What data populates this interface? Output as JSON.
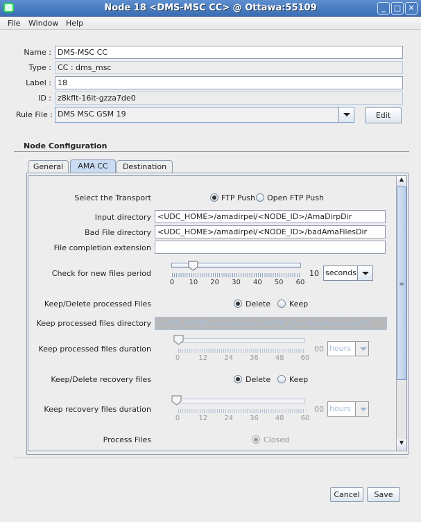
{
  "window": {
    "title": "Node 18 <DMS-MSC CC> @ Ottawa:55109",
    "controls": [
      "_",
      "□",
      "✕"
    ]
  },
  "menu": [
    "File",
    "Window",
    "Help"
  ],
  "form": {
    "name": {
      "label": "Name :",
      "value": "DMS-MSC CC"
    },
    "type": {
      "label": "Type :",
      "value": "CC : dms_msc"
    },
    "label": {
      "label": "Label :",
      "value": "18"
    },
    "id": {
      "label": "ID :",
      "value": "z8kflt-16it-gzza7de0"
    },
    "rule_file": {
      "label": "Rule File :",
      "value": "DMS MSC GSM 19",
      "edit": "Edit"
    }
  },
  "node_config": {
    "title": "Node Configuration",
    "tabs": [
      {
        "label": "General"
      },
      {
        "label": "AMA CC",
        "active": true
      },
      {
        "label": "Destination"
      }
    ],
    "transport": {
      "label": "Select the Transport",
      "options": [
        "FTP Push",
        "Open FTP Push"
      ],
      "selected": "FTP Push"
    },
    "input_dir": {
      "label": "Input directory",
      "value": "<UDC_HOME>/amadirpei/<NODE_ID>/AmaDirpDir"
    },
    "bad_dir": {
      "label": "Bad File directory",
      "value": "<UDC_HOME>/amadirpei/<NODE_ID>/badAmaFilesDir"
    },
    "completion_ext": {
      "label": "File completion extension",
      "value": ""
    },
    "check_period": {
      "label": "Check for new files period",
      "value": 10,
      "value_text": "10",
      "min": 0,
      "max": 60,
      "ticks": [
        "0",
        "10",
        "20",
        "30",
        "40",
        "50",
        "60"
      ],
      "unit": "seconds"
    },
    "keep_delete_processed": {
      "label": "Keep/Delete processed Files",
      "options": [
        "Delete",
        "Keep"
      ],
      "selected": "Delete"
    },
    "keep_processed_dir": {
      "label": "Keep processed files directory",
      "value": "<UDC_HOME>/amadirpei/<NODE_ID>/AmaFilesKeepDir"
    },
    "keep_processed_duration": {
      "label": "Keep processed files duration",
      "value": 0,
      "value_text": "00",
      "ticks": [
        "0",
        "12",
        "24",
        "36",
        "48",
        "60"
      ],
      "unit": "hours"
    },
    "keep_delete_recovery": {
      "label": "Keep/Delete recovery files",
      "options": [
        "Delete",
        "Keep"
      ],
      "selected": "Delete"
    },
    "keep_recovery_duration": {
      "label": "Keep recovery files duration",
      "value": 0,
      "value_text": "00",
      "ticks": [
        "0",
        "12",
        "24",
        "36",
        "48",
        "60"
      ],
      "unit": "hours"
    },
    "process_files": {
      "label": "Process Files",
      "option": "Closed"
    }
  },
  "buttons": {
    "cancel": "Cancel",
    "save": "Save"
  }
}
